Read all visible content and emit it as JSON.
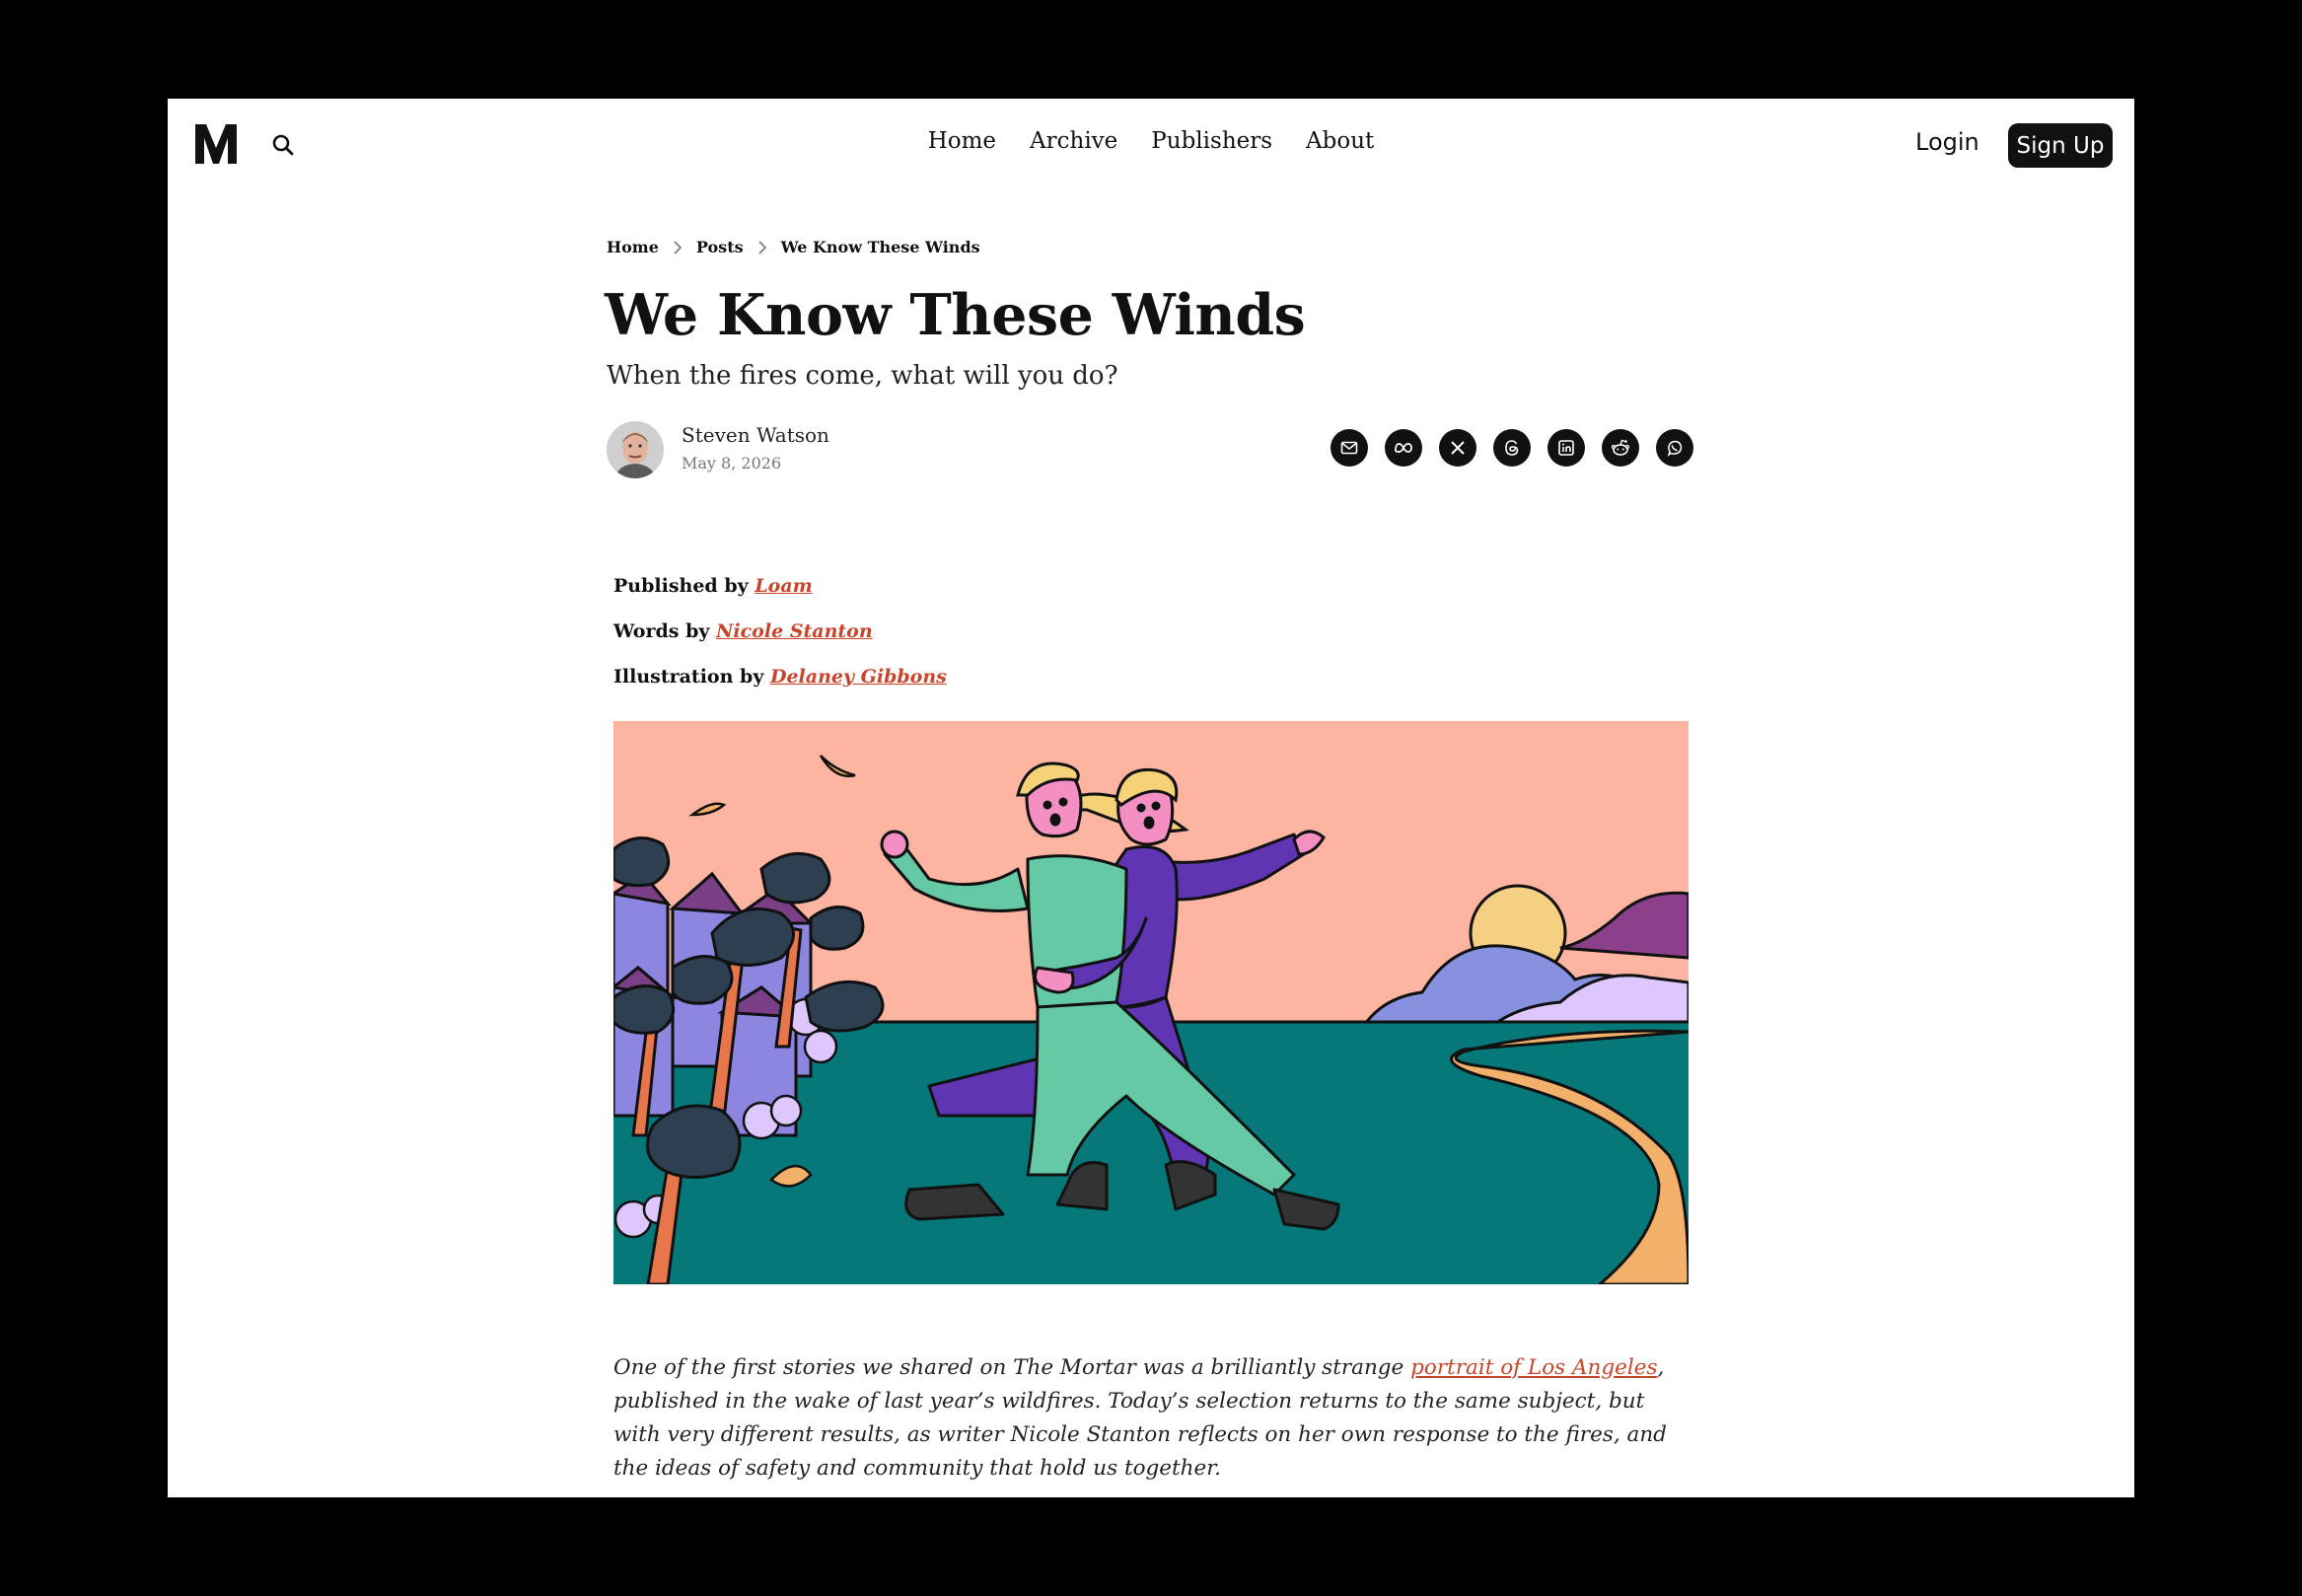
{
  "header": {
    "logo_text": "M",
    "nav": [
      "Home",
      "Archive",
      "Publishers",
      "About"
    ],
    "login_label": "Login",
    "signup_label": "Sign Up"
  },
  "breadcrumb": [
    "Home",
    "Posts",
    "We Know These Winds"
  ],
  "article": {
    "title": "We Know These Winds",
    "subtitle": "When the fires come, what will you do?",
    "author": "Steven Watson",
    "date": "May 8, 2026"
  },
  "share_icons": [
    "mail-icon",
    "meta-icon",
    "x-icon",
    "threads-icon",
    "linkedin-icon",
    "reddit-icon",
    "whatsapp-icon"
  ],
  "credits": {
    "published_prefix": "Published by",
    "published_name": "Loam",
    "words_prefix": "Words by",
    "words_name": "Nicole Stanton",
    "illustration_prefix": "Illustration by",
    "illustration_name": "Delaney Gibbons"
  },
  "body": {
    "part1": "One of the first stories we shared on The Mortar was a brilliantly strange ",
    "link": "portrait of Los Angeles",
    "part2": ", published in the wake of last year’s wildfires. Today’s selection returns to the same subject, but with very different results, as writer Nicole Stanton reflects on her own response to the fires, and the ideas of safety and community that hold us together."
  },
  "colors": {
    "link": "#c9442a",
    "sky": "#fdb4a0",
    "ground": "#06787a",
    "figure_green": "#66c9a6",
    "figure_purple": "#5f35b4"
  }
}
